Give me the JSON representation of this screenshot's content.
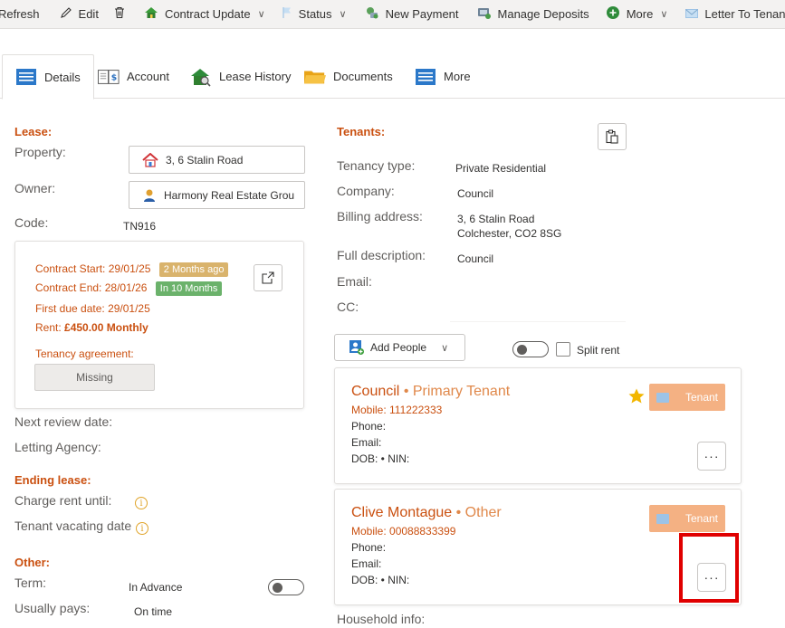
{
  "toolbar": {
    "refresh": "Refresh",
    "edit": "Edit",
    "contract_update": "Contract Update",
    "status": "Status",
    "new_payment": "New Payment",
    "manage_deposits": "Manage Deposits",
    "more": "More",
    "letter_to_tenant": "Letter To Tenant"
  },
  "tabs": [
    "Details",
    "Account",
    "Lease History",
    "Documents",
    "More"
  ],
  "lease": {
    "heading": "Lease:",
    "property_label": "Property:",
    "property_value": "3, 6 Stalin Road",
    "owner_label": "Owner:",
    "owner_value": "Harmony Real Estate Grou",
    "code_label": "Code:",
    "code_value": "TN916"
  },
  "contract": {
    "start_label": "Contract Start:",
    "start_value": "29/01/25",
    "start_badge": "2 Months ago",
    "end_label": "Contract End:",
    "end_value": "28/01/26",
    "end_badge": "In 10 Months",
    "first_due_label": "First due date:",
    "first_due_value": "29/01/25",
    "rent_label": "Rent:",
    "rent_value": "£450.00",
    "rent_freq": "Monthly",
    "agreement_label": "Tenancy agreement:",
    "agreement_value": "Missing"
  },
  "left_misc": {
    "next_review": "Next review date:",
    "letting_agency": "Letting Agency:",
    "ending_heading": "Ending lease:",
    "charge_rent": "Charge rent until:",
    "tenant_vacating": "Tenant vacating date",
    "other_heading": "Other:",
    "term_label": "Term:",
    "term_value": "In Advance",
    "usually_pays_label": "Usually pays:",
    "usually_pays_value": "On time"
  },
  "tenants": {
    "heading": "Tenants:",
    "tenancy_type_label": "Tenancy type:",
    "tenancy_type_value": "Private Residential",
    "company_label": "Company:",
    "company_value": "Council",
    "billing_label": "Billing address:",
    "billing_line1": "3, 6 Stalin Road",
    "billing_line2": "Colchester, CO2 8SG",
    "full_desc_label": "Full description:",
    "full_desc_value": "Council",
    "email_label": "Email:",
    "cc_label": "CC:",
    "add_people": "Add People",
    "split_rent": "Split rent",
    "household_info": "Household info:"
  },
  "people": [
    {
      "name": "Council",
      "role": "• Primary Tenant",
      "mobile": "Mobile: 111222333",
      "phone": "Phone:",
      "email": "Email:",
      "dob": "DOB:  • NIN:",
      "tag": "Tenant",
      "ellipsis": "···"
    },
    {
      "name": "Clive Montague",
      "role": "• Other",
      "mobile": "Mobile: 00088833399",
      "phone": "Phone:",
      "email": "Email:",
      "dob": "DOB:  • NIN:",
      "tag": "Tenant",
      "ellipsis": "···"
    }
  ],
  "colors": {
    "accent_orange": "#ca5010",
    "badge_tan": "#d9b36c",
    "badge_green": "#6bb26b",
    "tenant_tag": "#f4b183",
    "highlight_red": "#e00000"
  },
  "icons": {
    "refresh": "refresh-icon",
    "edit": "pencil-icon",
    "delete": "trash-icon",
    "contract_update": "house-icon",
    "status": "flag-icon",
    "new_payment": "payment-icon",
    "manage_deposits": "deposit-icon",
    "more": "plus-circle-icon",
    "letter": "envelope-icon"
  }
}
